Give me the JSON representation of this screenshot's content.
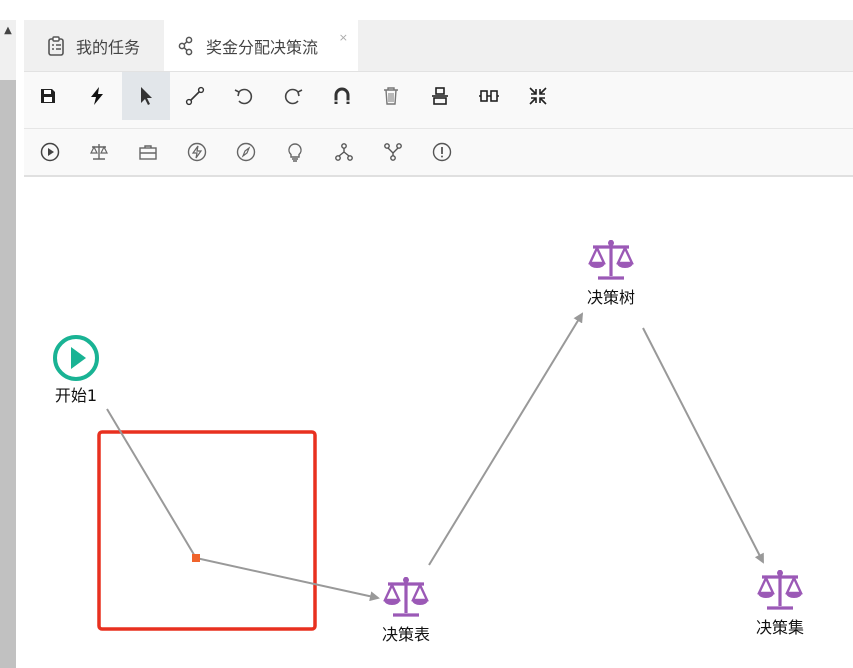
{
  "tabs": [
    {
      "label": "我的任务",
      "icon": "clipboard-icon",
      "active": false
    },
    {
      "label": "奖金分配决策流",
      "icon": "flow-icon",
      "active": true,
      "close": "×"
    }
  ],
  "toolbar_main": [
    {
      "name": "save",
      "icon": "save-icon"
    },
    {
      "name": "run",
      "icon": "lightning-icon"
    },
    {
      "name": "select",
      "icon": "pointer-icon",
      "active": true
    },
    {
      "name": "connect",
      "icon": "line-connect-icon"
    },
    {
      "name": "undo",
      "icon": "undo-icon"
    },
    {
      "name": "redo",
      "icon": "redo-icon"
    },
    {
      "name": "snap",
      "icon": "magnet-icon"
    },
    {
      "name": "delete",
      "icon": "trash-icon"
    },
    {
      "name": "align-vertical",
      "icon": "align-vertical-icon"
    },
    {
      "name": "align-horizontal",
      "icon": "align-horizontal-icon"
    },
    {
      "name": "fit",
      "icon": "compress-icon"
    }
  ],
  "toolbar_nodes": [
    {
      "name": "start-node",
      "icon": "play-circle-icon"
    },
    {
      "name": "decision-node",
      "icon": "scale-icon"
    },
    {
      "name": "action-node",
      "icon": "briefcase-icon"
    },
    {
      "name": "event-node",
      "icon": "lightning-circle-icon"
    },
    {
      "name": "script-node",
      "icon": "compass-icon"
    },
    {
      "name": "rule-node",
      "icon": "bulb-icon"
    },
    {
      "name": "fork-node",
      "icon": "fork-icon"
    },
    {
      "name": "join-node",
      "icon": "join-icon"
    },
    {
      "name": "end-node",
      "icon": "exclamation-circle-icon"
    }
  ],
  "nodes": {
    "start": {
      "label": "开始1",
      "icon": "play-circle-icon"
    },
    "table": {
      "label": "决策表",
      "icon": "scale-icon"
    },
    "tree": {
      "label": "决策树",
      "icon": "scale-icon"
    },
    "set": {
      "label": "决策集",
      "icon": "scale-icon"
    }
  },
  "colors": {
    "start": "#19b394",
    "decision": "#9b59b6",
    "edge": "#999999",
    "selection": "#e8301f",
    "handle": "#f0642c"
  }
}
